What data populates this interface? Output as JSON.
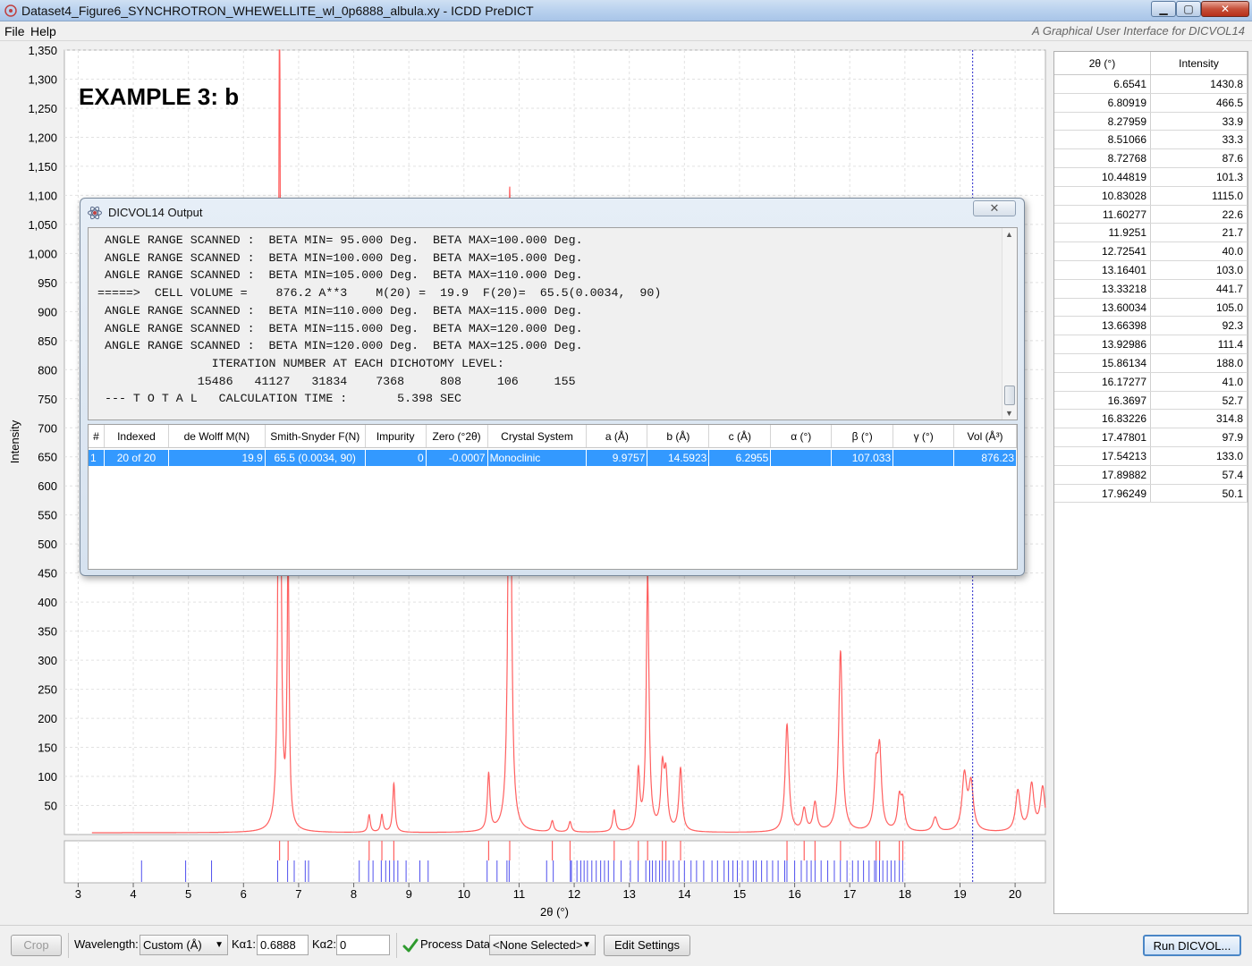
{
  "window": {
    "title": "Dataset4_Figure6_SYNCHROTRON_WHEWELLITE_wl_0p6888_albula.xy - ICDD PreDICT",
    "minimize_label": "▁",
    "maximize_label": "▢",
    "close_label": "✕"
  },
  "menu": {
    "file": "File",
    "help": "Help",
    "tagline": "A Graphical User Interface for DICVOL14"
  },
  "chart_data": {
    "type": "line",
    "annotation": "EXAMPLE 3: b",
    "xlabel": "2θ (°)",
    "ylabel": "Intensity",
    "xlim": [
      2.75,
      20.55
    ],
    "ylim": [
      0,
      1350
    ],
    "yticks": [
      50,
      100,
      150,
      200,
      250,
      300,
      350,
      400,
      450,
      500,
      550,
      600,
      650,
      700,
      750,
      800,
      850,
      900,
      950,
      1000,
      1050,
      1100,
      1150,
      1200,
      1250,
      1300,
      1350
    ],
    "ytick_labels": [
      "50",
      "100",
      "150",
      "200",
      "250",
      "300",
      "350",
      "400",
      "450",
      "500",
      "550",
      "600",
      "650",
      "700",
      "750",
      "800",
      "850",
      "900",
      "950",
      "1,000",
      "1,050",
      "1,100",
      "1,150",
      "1,200",
      "1,250",
      "1,300",
      "1,350"
    ],
    "xticks": [
      3,
      4,
      5,
      6,
      7,
      8,
      9,
      10,
      11,
      12,
      13,
      14,
      15,
      16,
      17,
      18,
      19,
      20
    ],
    "grid": true,
    "cursor_x": 19.23,
    "pattern_color": "#ff6060",
    "cursor_color": "#2a2acc",
    "series": [
      {
        "baseline": 3,
        "x_start": 3.25,
        "x_end": 20.55,
        "peaks": [
          {
            "x": 6.6541,
            "h": 1430,
            "w": 0.022
          },
          {
            "x": 6.80919,
            "h": 463,
            "w": 0.022
          },
          {
            "x": 8.27959,
            "h": 30,
            "w": 0.025
          },
          {
            "x": 8.51066,
            "h": 30,
            "w": 0.025
          },
          {
            "x": 8.72768,
            "h": 84,
            "w": 0.025
          },
          {
            "x": 10.44819,
            "h": 98,
            "w": 0.028
          },
          {
            "x": 10.83028,
            "h": 1112,
            "w": 0.028
          },
          {
            "x": 11.60277,
            "h": 19,
            "w": 0.03
          },
          {
            "x": 11.9251,
            "h": 18,
            "w": 0.03
          },
          {
            "x": 12.72541,
            "h": 37,
            "w": 0.03
          },
          {
            "x": 13.16401,
            "h": 100,
            "w": 0.03
          },
          {
            "x": 13.33218,
            "h": 438,
            "w": 0.03
          },
          {
            "x": 13.60034,
            "h": 102,
            "w": 0.035
          },
          {
            "x": 13.66398,
            "h": 89,
            "w": 0.035
          },
          {
            "x": 13.92986,
            "h": 108,
            "w": 0.035
          },
          {
            "x": 15.86134,
            "h": 185,
            "w": 0.04
          },
          {
            "x": 16.17277,
            "h": 38,
            "w": 0.04
          },
          {
            "x": 16.3697,
            "h": 49,
            "w": 0.04
          },
          {
            "x": 16.83226,
            "h": 311,
            "w": 0.04
          },
          {
            "x": 17.47801,
            "h": 95,
            "w": 0.04
          },
          {
            "x": 17.54213,
            "h": 130,
            "w": 0.04
          },
          {
            "x": 17.89882,
            "h": 54,
            "w": 0.04
          },
          {
            "x": 17.96249,
            "h": 47,
            "w": 0.04
          },
          {
            "x": 18.55,
            "h": 25,
            "w": 0.05
          },
          {
            "x": 19.08,
            "h": 95,
            "w": 0.05
          },
          {
            "x": 19.2,
            "h": 80,
            "w": 0.05
          },
          {
            "x": 20.05,
            "h": 70,
            "w": 0.05
          },
          {
            "x": 20.3,
            "h": 80,
            "w": 0.05
          },
          {
            "x": 20.5,
            "h": 75,
            "w": 0.05
          }
        ]
      }
    ],
    "observed_ticks": [
      6.6541,
      6.80919,
      8.27959,
      8.51066,
      8.72768,
      10.44819,
      10.83028,
      11.60277,
      11.9251,
      12.72541,
      13.16401,
      13.33218,
      13.60034,
      13.66398,
      13.92986,
      15.86134,
      16.17277,
      16.3697,
      16.83226,
      17.47801,
      17.54213,
      17.89882,
      17.96249
    ],
    "calc_ticks": [
      4.15,
      4.95,
      5.42,
      6.62,
      6.8,
      6.92,
      7.12,
      7.18,
      8.1,
      8.27,
      8.35,
      8.5,
      8.58,
      8.65,
      8.73,
      8.8,
      8.95,
      9.2,
      9.35,
      10.42,
      10.6,
      10.78,
      10.82,
      11.5,
      11.62,
      11.93,
      11.95,
      12.05,
      12.12,
      12.18,
      12.24,
      12.32,
      12.4,
      12.48,
      12.55,
      12.62,
      12.72,
      12.85,
      13.02,
      13.16,
      13.3,
      13.37,
      13.42,
      13.48,
      13.55,
      13.6,
      13.66,
      13.72,
      13.8,
      13.9,
      14.0,
      14.12,
      14.22,
      14.35,
      14.5,
      14.6,
      14.72,
      14.8,
      14.88,
      14.96,
      15.05,
      15.15,
      15.25,
      15.3,
      15.4,
      15.5,
      15.6,
      15.7,
      15.82,
      15.86,
      16.0,
      16.12,
      16.22,
      16.3,
      16.37,
      16.48,
      16.6,
      16.72,
      16.83,
      16.95,
      17.05,
      17.15,
      17.25,
      17.35,
      17.45,
      17.48,
      17.54,
      17.6,
      17.68,
      17.75,
      17.82,
      17.9,
      17.96
    ]
  },
  "peak_table": {
    "headers": [
      "2θ (°)",
      "Intensity"
    ],
    "rows": [
      [
        "6.6541",
        "1430.8"
      ],
      [
        "6.80919",
        "466.5"
      ],
      [
        "8.27959",
        "33.9"
      ],
      [
        "8.51066",
        "33.3"
      ],
      [
        "8.72768",
        "87.6"
      ],
      [
        "10.44819",
        "101.3"
      ],
      [
        "10.83028",
        "1115.0"
      ],
      [
        "11.60277",
        "22.6"
      ],
      [
        "11.9251",
        "21.7"
      ],
      [
        "12.72541",
        "40.0"
      ],
      [
        "13.16401",
        "103.0"
      ],
      [
        "13.33218",
        "441.7"
      ],
      [
        "13.60034",
        "105.0"
      ],
      [
        "13.66398",
        "92.3"
      ],
      [
        "13.92986",
        "111.4"
      ],
      [
        "15.86134",
        "188.0"
      ],
      [
        "16.17277",
        "41.0"
      ],
      [
        "16.3697",
        "52.7"
      ],
      [
        "16.83226",
        "314.8"
      ],
      [
        "17.47801",
        "97.9"
      ],
      [
        "17.54213",
        "133.0"
      ],
      [
        "17.89882",
        "57.4"
      ],
      [
        "17.96249",
        "50.1"
      ]
    ]
  },
  "dialog": {
    "title": "DICVOL14 Output",
    "close_label": "✕",
    "console_text": " ANGLE RANGE SCANNED :  BETA MIN= 95.000 Deg.  BETA MAX=100.000 Deg.\n ANGLE RANGE SCANNED :  BETA MIN=100.000 Deg.  BETA MAX=105.000 Deg.\n ANGLE RANGE SCANNED :  BETA MIN=105.000 Deg.  BETA MAX=110.000 Deg.\n=====>  CELL VOLUME =    876.2 A**3    M(20) =  19.9  F(20)=  65.5(0.0034,  90)\n ANGLE RANGE SCANNED :  BETA MIN=110.000 Deg.  BETA MAX=115.000 Deg.\n ANGLE RANGE SCANNED :  BETA MIN=115.000 Deg.  BETA MAX=120.000 Deg.\n ANGLE RANGE SCANNED :  BETA MIN=120.000 Deg.  BETA MAX=125.000 Deg.\n                ITERATION NUMBER AT EACH DICHOTOMY LEVEL:\n              15486   41127   31834    7368     808     106     155\n --- T O T A L   CALCULATION TIME :       5.398 SEC",
    "results_headers": [
      "#",
      "Indexed",
      "de Wolff M(N)",
      "Smith-Snyder F(N)",
      "Impurity",
      "Zero (°2θ)",
      "Crystal System",
      "a (Å)",
      "b (Å)",
      "c (Å)",
      "α (°)",
      "β (°)",
      "γ (°)",
      "Vol (Å³)"
    ],
    "results_rows": [
      [
        "1",
        "20 of 20",
        "19.9",
        "65.5 (0.0034, 90)",
        "0",
        "-0.0007",
        "Monoclinic",
        "9.9757",
        "14.5923",
        "6.2955",
        "",
        "107.033",
        "",
        "876.23"
      ]
    ]
  },
  "toolbar": {
    "crop": "Crop",
    "wavelength_label": "Wavelength:",
    "wavelength_value": "Custom (Å)",
    "ka1_label": "Kα1:",
    "ka1_value": "0.6888",
    "ka2_label": "Kα2:",
    "ka2_value": "0",
    "process_label": "Process Data:",
    "process_value": "<None Selected>",
    "edit_settings": "Edit Settings",
    "run": "Run DICVOL..."
  }
}
